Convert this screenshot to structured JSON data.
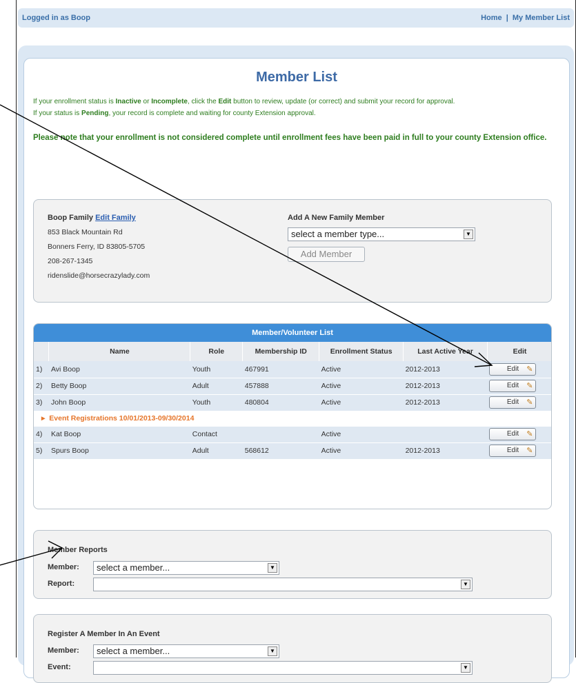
{
  "topbar": {
    "logged_in": "Logged in as Boop",
    "home_link": "Home",
    "separator": "|",
    "member_list_link": "My Member List"
  },
  "page": {
    "title": "Member List",
    "intro_1_pre": "If your enrollment status is ",
    "intro_1_inactive": "Inactive",
    "intro_1_or": " or ",
    "intro_1_incomplete": "Incomplete",
    "intro_1_mid": ", click the ",
    "intro_1_edit": "Edit",
    "intro_1_post": " button to review, update (or correct) and submit your record for approval.",
    "intro_2_pre": "If your status is ",
    "intro_2_pending": "Pending",
    "intro_2_post": ", your record is complete and waiting for county Extension approval.",
    "note": "Please note that your enrollment is not considered complete until enrollment fees have been paid in full to your county Extension office."
  },
  "family": {
    "name": "Boop Family",
    "edit_link": "Edit Family",
    "address1": "853 Black Mountain Rd",
    "address2": "Bonners Ferry, ID 83805-5705",
    "phone": "208-267-1345",
    "email": "ridenslide@horsecrazylady.com",
    "add_title": "Add A New Family Member",
    "member_type_select": "select a member type...",
    "add_button": "Add Member"
  },
  "member_list": {
    "title": "Member/Volunteer List",
    "columns": [
      "Name",
      "Role",
      "Membership ID",
      "Enrollment Status",
      "Last Active Year",
      "Edit"
    ],
    "rows": [
      {
        "num": "1)",
        "name": "Avi Boop",
        "role": "Youth",
        "id": "467991",
        "status": "Active",
        "year": "2012-2013",
        "edit": "Edit"
      },
      {
        "num": "2)",
        "name": "Betty Boop",
        "role": "Adult",
        "id": "457888",
        "status": "Active",
        "year": "2012-2013",
        "edit": "Edit"
      },
      {
        "num": "3)",
        "name": "John Boop",
        "role": "Youth",
        "id": "480804",
        "status": "Active",
        "year": "2012-2013",
        "edit": "Edit"
      },
      {
        "num": "4)",
        "name": "Kat Boop",
        "role": "Contact",
        "id": "",
        "status": "Active",
        "year": "",
        "edit": "Edit"
      },
      {
        "num": "5)",
        "name": "Spurs Boop",
        "role": "Adult",
        "id": "568612",
        "status": "Active",
        "year": "2012-2013",
        "edit": "Edit"
      }
    ],
    "event_reg": "Event Registrations 10/01/2013-09/30/2014"
  },
  "reports": {
    "title": "Member Reports",
    "member_label": "Member:",
    "member_select": "select a member...",
    "report_label": "Report:",
    "report_select": ""
  },
  "register": {
    "title": "Register A Member In An Event",
    "member_label": "Member:",
    "member_select": "select a member...",
    "event_label": "Event:",
    "event_select": ""
  }
}
